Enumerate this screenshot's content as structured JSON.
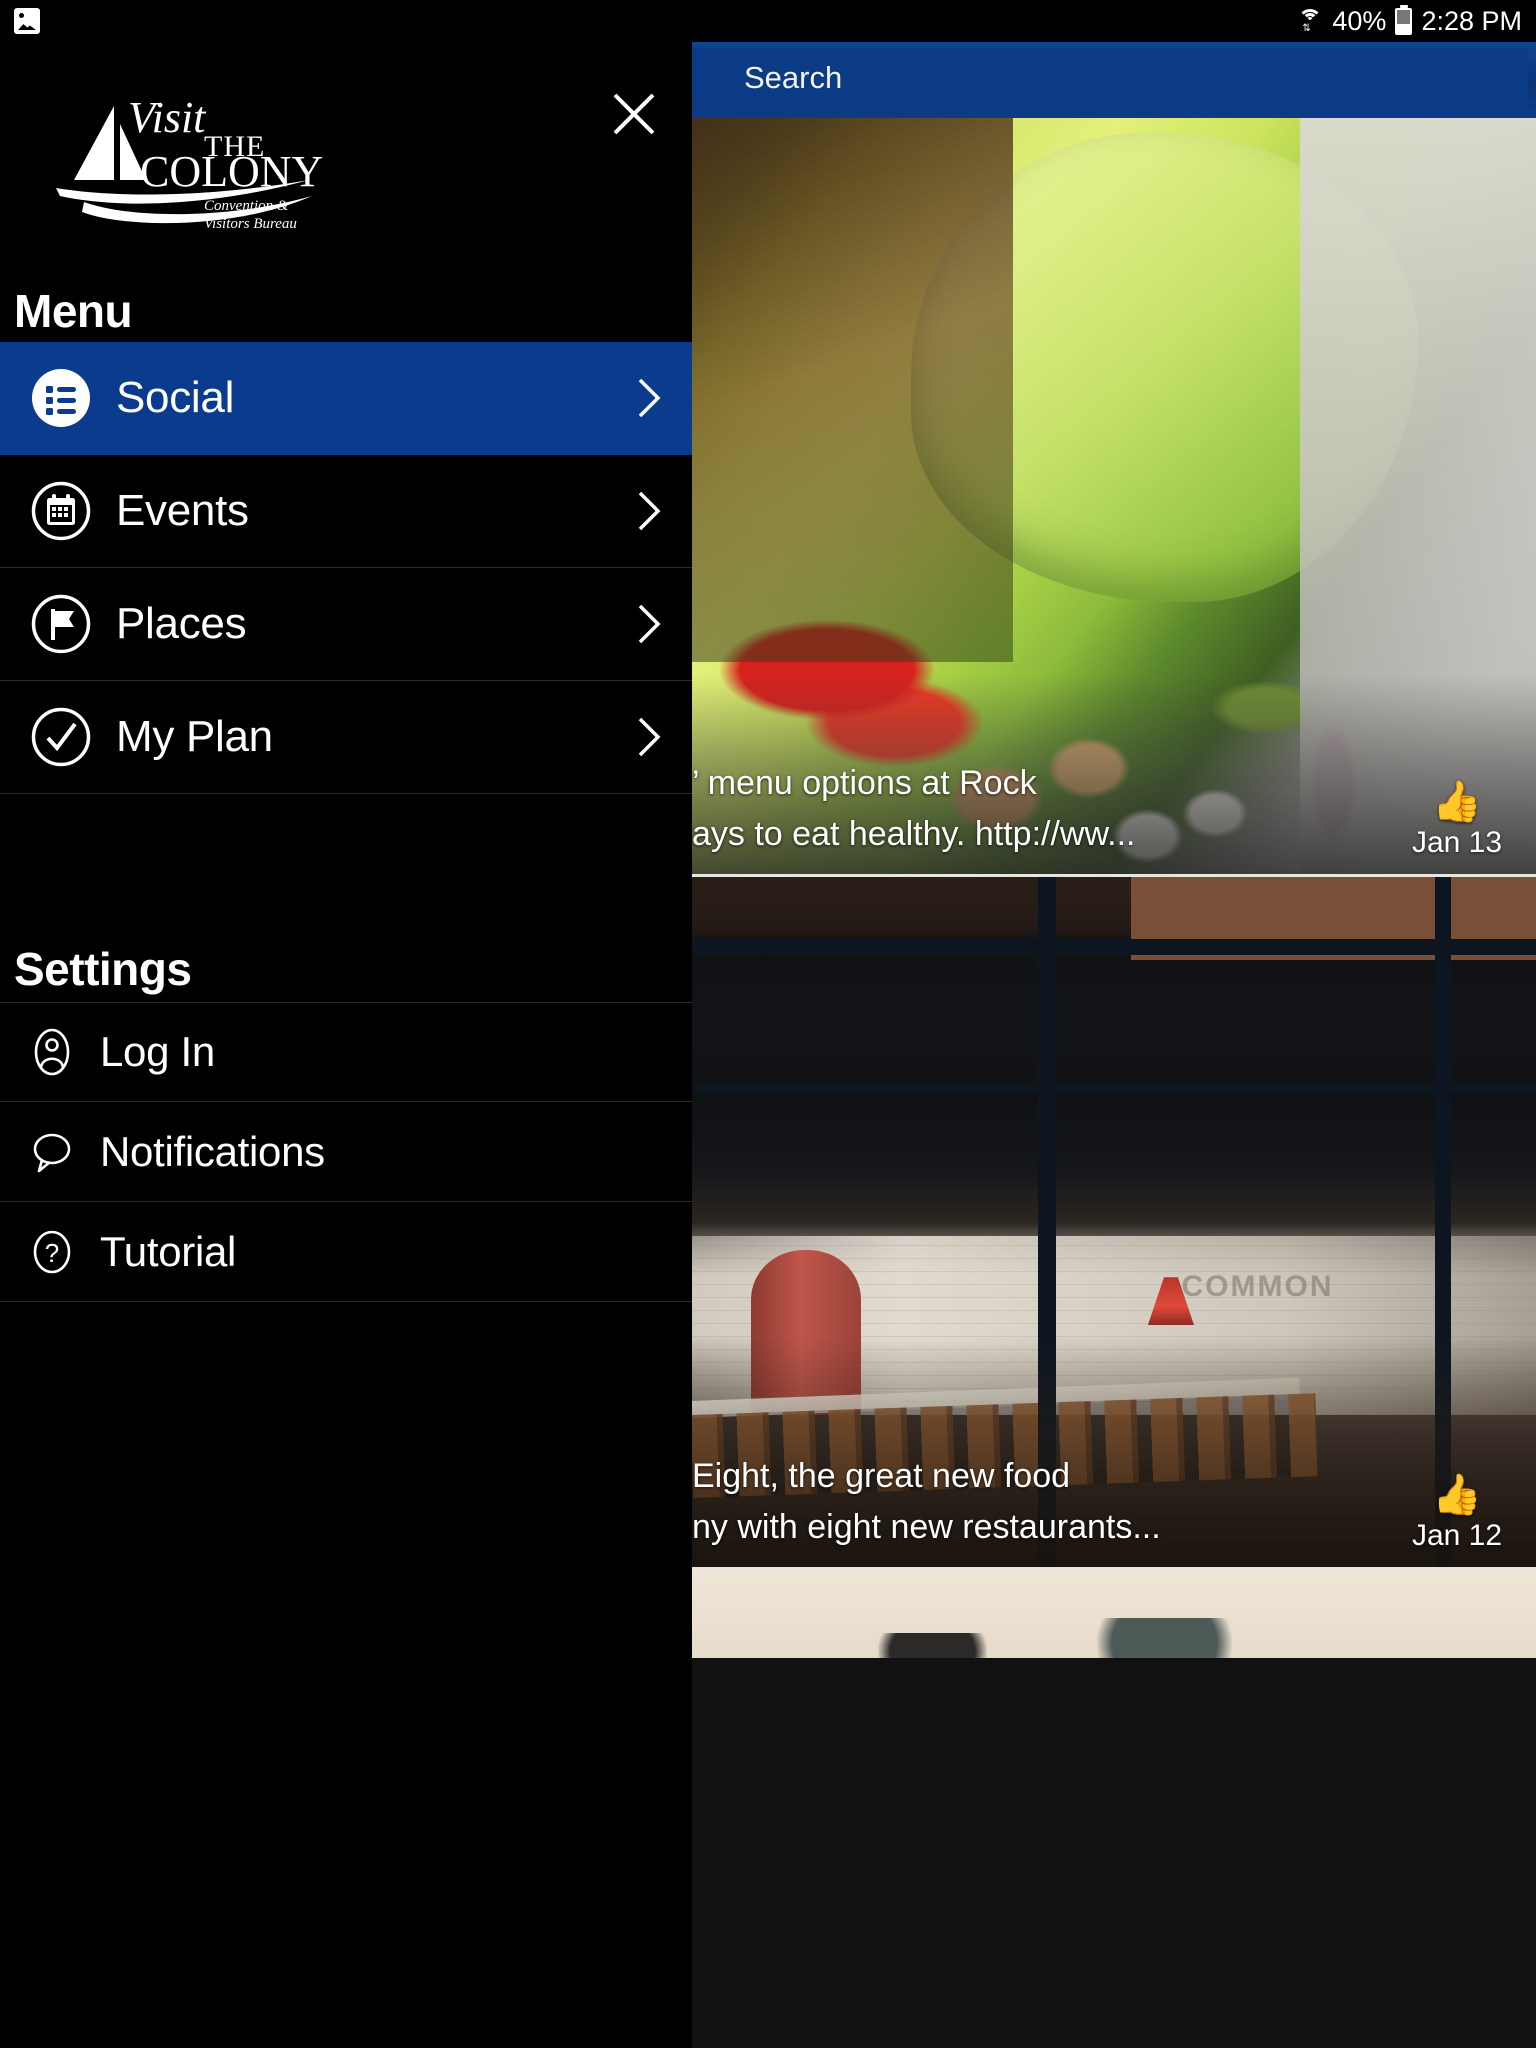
{
  "status_bar": {
    "notification_icon": "image-icon",
    "wifi_icon": "wifi-icon",
    "battery_percent": "40%",
    "battery_icon": "battery-icon",
    "time": "2:28 PM"
  },
  "drawer": {
    "close_icon": "close-icon",
    "logo": {
      "line1": "Visit",
      "line2": "THE",
      "line3": "COLONY",
      "tagline1": "Convention &",
      "tagline2": "Visitors Bureau",
      "mark": "sailboat-icon"
    },
    "menu_heading": "Menu",
    "menu_items": [
      {
        "label": "Social",
        "icon": "list-icon",
        "active": true,
        "chevron": "chevron-right-icon"
      },
      {
        "label": "Events",
        "icon": "calendar-icon",
        "active": false,
        "chevron": "chevron-right-icon"
      },
      {
        "label": "Places",
        "icon": "flag-icon",
        "active": false,
        "chevron": "chevron-right-icon"
      },
      {
        "label": "My Plan",
        "icon": "check-icon",
        "active": false,
        "chevron": "chevron-right-icon"
      }
    ],
    "settings_heading": "Settings",
    "settings_items": [
      {
        "label": "Log In",
        "icon": "person-icon"
      },
      {
        "label": "Notifications",
        "icon": "speech-bubble-icon"
      },
      {
        "label": "Tutorial",
        "icon": "question-mark-icon"
      }
    ]
  },
  "search": {
    "label": "Search",
    "placeholder": "Search"
  },
  "feed": {
    "posts": [
      {
        "image": "salad-photo",
        "caption_line1": "’ menu options at Rock",
        "caption_line2": "ays to eat healthy. http://ww...",
        "like_icon": "thumbs-up-icon",
        "date": "Jan 13"
      },
      {
        "image": "restaurant-interior-photo",
        "caption_line1": "Eight, the great new food",
        "caption_line2": "ny with eight new restaurants...",
        "like_icon": "thumbs-up-icon",
        "date": "Jan 12",
        "wall_text": "COMMON"
      },
      {
        "image": "cream-background-photo"
      }
    ]
  },
  "colors": {
    "accent_blue": "#0a3b8c",
    "search_blue": "#0b3b85",
    "drawer_bg": "#000000",
    "divider": "#2b2b2b",
    "text": "#ffffff"
  }
}
